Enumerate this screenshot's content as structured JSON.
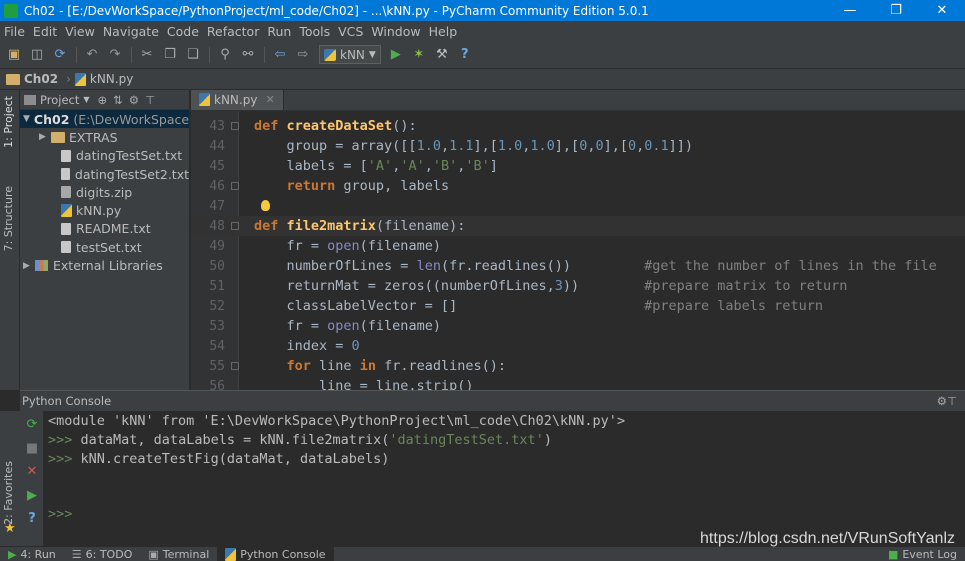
{
  "window": {
    "title": "Ch02 - [E:/DevWorkSpace/PythonProject/ml_code/Ch02] - ...\\kNN.py - PyCharm Community Edition 5.0.1",
    "minimize": "—",
    "maximize": "❐",
    "close": "✕"
  },
  "menu": [
    "File",
    "Edit",
    "View",
    "Navigate",
    "Code",
    "Refactor",
    "Run",
    "Tools",
    "VCS",
    "Window",
    "Help"
  ],
  "toolbar": {
    "icons": [
      "folder-open-icon",
      "save-icon",
      "sync-icon",
      "undo-icon",
      "redo-icon",
      "cut-icon",
      "copy-icon",
      "paste-icon",
      "find-icon",
      "replace-icon",
      "back-icon",
      "forward-icon"
    ],
    "run_config": "kNN",
    "run_icon": "▶",
    "debug_icon": "✶",
    "settings_icon": "⚒",
    "help_icon": "?"
  },
  "breadcrumb": {
    "project": "Ch02",
    "file": "kNN.py"
  },
  "side_tabs": {
    "project": "1: Project",
    "structure": "7: Structure",
    "favorites": "2: Favorites"
  },
  "project_panel": {
    "title": "Project",
    "root_name": "Ch02",
    "root_path": "(E:\\DevWorkSpace",
    "items": [
      {
        "name": "EXTRAS",
        "type": "folder"
      },
      {
        "name": "datingTestSet.txt",
        "type": "txt"
      },
      {
        "name": "datingTestSet2.txt",
        "type": "txt"
      },
      {
        "name": "digits.zip",
        "type": "zip"
      },
      {
        "name": "kNN.py",
        "type": "py"
      },
      {
        "name": "README.txt",
        "type": "txt"
      },
      {
        "name": "testSet.txt",
        "type": "txt"
      }
    ],
    "external": "External Libraries"
  },
  "editor": {
    "tab": "kNN.py",
    "line_numbers": [
      "43",
      "44",
      "45",
      "46",
      "47",
      "48",
      "49",
      "50",
      "51",
      "52",
      "53",
      "54",
      "55",
      "56"
    ]
  },
  "console": {
    "title": "Python Console",
    "module_line": "<module 'kNN' from 'E:\\DevWorkSpace\\PythonProject\\ml_code\\Ch02\\kNN.py'>",
    "prompt": ">>>",
    "cmd1_a": "dataMat, dataLabels = kNN.file2matrix(",
    "cmd1_str": "'datingTestSet.txt'",
    "cmd1_b": ")",
    "cmd2": "kNN.createTestFig(dataMat, dataLabels)"
  },
  "status_tabs": [
    "4: Run",
    "6: TODO",
    "Terminal",
    "Python Console"
  ],
  "event_log": "Event Log",
  "watermark": "https://blog.csdn.net/VRunSoftYanlz"
}
